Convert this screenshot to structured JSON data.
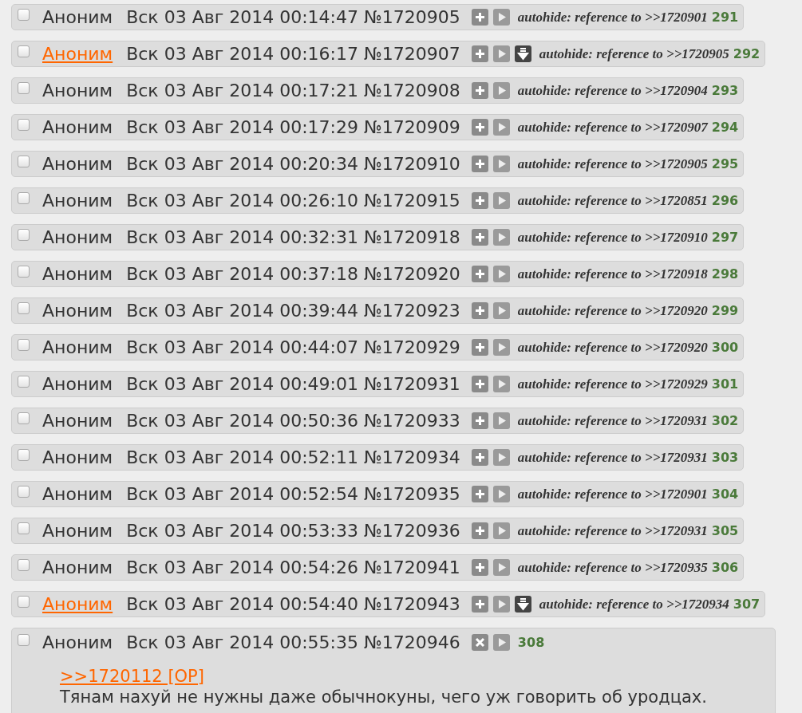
{
  "posts": [
    {
      "author": "Аноним",
      "author_linked": false,
      "checked": false,
      "date": "Вск 03 Авг 2014 00:14:47",
      "number": "№1720905",
      "expanded": false,
      "download": false,
      "note": "autohide: reference to >>1720901",
      "count": "291"
    },
    {
      "author": "Аноним",
      "author_linked": true,
      "checked": false,
      "date": "Вск 03 Авг 2014 00:16:17",
      "number": "№1720907",
      "expanded": false,
      "download": true,
      "note": "autohide: reference to >>1720905",
      "count": "292"
    },
    {
      "author": "Аноним",
      "author_linked": false,
      "checked": false,
      "date": "Вск 03 Авг 2014 00:17:21",
      "number": "№1720908",
      "expanded": false,
      "download": false,
      "note": "autohide: reference to >>1720904",
      "count": "293"
    },
    {
      "author": "Аноним",
      "author_linked": false,
      "checked": false,
      "date": "Вск 03 Авг 2014 00:17:29",
      "number": "№1720909",
      "expanded": false,
      "download": false,
      "note": "autohide: reference to >>1720907",
      "count": "294"
    },
    {
      "author": "Аноним",
      "author_linked": false,
      "checked": false,
      "date": "Вск 03 Авг 2014 00:20:34",
      "number": "№1720910",
      "expanded": false,
      "download": false,
      "note": "autohide: reference to >>1720905",
      "count": "295"
    },
    {
      "author": "Аноним",
      "author_linked": false,
      "checked": false,
      "date": "Вск 03 Авг 2014 00:26:10",
      "number": "№1720915",
      "expanded": false,
      "download": false,
      "note": "autohide: reference to >>1720851",
      "count": "296"
    },
    {
      "author": "Аноним",
      "author_linked": false,
      "checked": false,
      "date": "Вск 03 Авг 2014 00:32:31",
      "number": "№1720918",
      "expanded": false,
      "download": false,
      "note": "autohide: reference to >>1720910",
      "count": "297"
    },
    {
      "author": "Аноним",
      "author_linked": false,
      "checked": false,
      "date": "Вск 03 Авг 2014 00:37:18",
      "number": "№1720920",
      "expanded": false,
      "download": false,
      "note": "autohide: reference to >>1720918",
      "count": "298"
    },
    {
      "author": "Аноним",
      "author_linked": false,
      "checked": false,
      "date": "Вск 03 Авг 2014 00:39:44",
      "number": "№1720923",
      "expanded": false,
      "download": false,
      "note": "autohide: reference to >>1720920",
      "count": "299"
    },
    {
      "author": "Аноним",
      "author_linked": false,
      "checked": false,
      "date": "Вск 03 Авг 2014 00:44:07",
      "number": "№1720929",
      "expanded": false,
      "download": false,
      "note": "autohide: reference to >>1720920",
      "count": "300"
    },
    {
      "author": "Аноним",
      "author_linked": false,
      "checked": false,
      "date": "Вск 03 Авг 2014 00:49:01",
      "number": "№1720931",
      "expanded": false,
      "download": false,
      "note": "autohide: reference to >>1720929",
      "count": "301"
    },
    {
      "author": "Аноним",
      "author_linked": false,
      "checked": false,
      "date": "Вск 03 Авг 2014 00:50:36",
      "number": "№1720933",
      "expanded": false,
      "download": false,
      "note": "autohide: reference to >>1720931",
      "count": "302"
    },
    {
      "author": "Аноним",
      "author_linked": false,
      "checked": false,
      "date": "Вск 03 Авг 2014 00:52:11",
      "number": "№1720934",
      "expanded": false,
      "download": false,
      "note": "autohide: reference to >>1720931",
      "count": "303"
    },
    {
      "author": "Аноним",
      "author_linked": false,
      "checked": false,
      "date": "Вск 03 Авг 2014 00:52:54",
      "number": "№1720935",
      "expanded": false,
      "download": false,
      "note": "autohide: reference to >>1720901",
      "count": "304"
    },
    {
      "author": "Аноним",
      "author_linked": false,
      "checked": false,
      "date": "Вск 03 Авг 2014 00:53:33",
      "number": "№1720936",
      "expanded": false,
      "download": false,
      "note": "autohide: reference to >>1720931",
      "count": "305"
    },
    {
      "author": "Аноним",
      "author_linked": false,
      "checked": false,
      "date": "Вск 03 Авг 2014 00:54:26",
      "number": "№1720941",
      "expanded": false,
      "download": false,
      "note": "autohide: reference to >>1720935",
      "count": "306"
    },
    {
      "author": "Аноним",
      "author_linked": true,
      "checked": false,
      "date": "Вск 03 Авг 2014 00:54:40",
      "number": "№1720943",
      "expanded": false,
      "download": true,
      "note": "autohide: reference to >>1720934",
      "count": "307"
    },
    {
      "author": "Аноним",
      "author_linked": false,
      "checked": false,
      "date": "Вск 03 Авг 2014 00:55:35",
      "number": "№1720946",
      "expanded": true,
      "download": false,
      "count": "308",
      "reply_link": ">>1720112 [OP]",
      "body": "Тянам нахуй не нужны даже обычнокуны, чего уж говорить об уродцах."
    }
  ]
}
